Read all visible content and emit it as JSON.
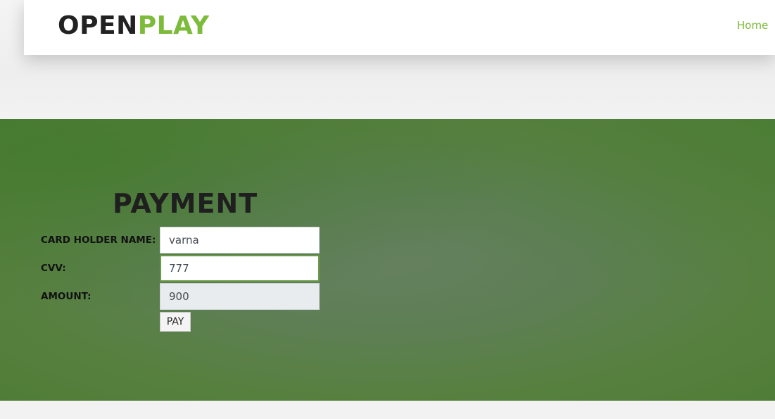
{
  "brand": {
    "part1": "OPEN",
    "part2": "PLAY",
    "accent_color": "#7dbb3a"
  },
  "nav": {
    "home_label": "Home"
  },
  "payment": {
    "title": "PAYMENT",
    "card_holder_label": "CARD HOLDER NAME:",
    "card_holder_value": "varna",
    "cvv_label": "CVV:",
    "cvv_value": "777",
    "amount_label": "AMOUNT:",
    "amount_value": "900",
    "pay_label": "PAY"
  }
}
